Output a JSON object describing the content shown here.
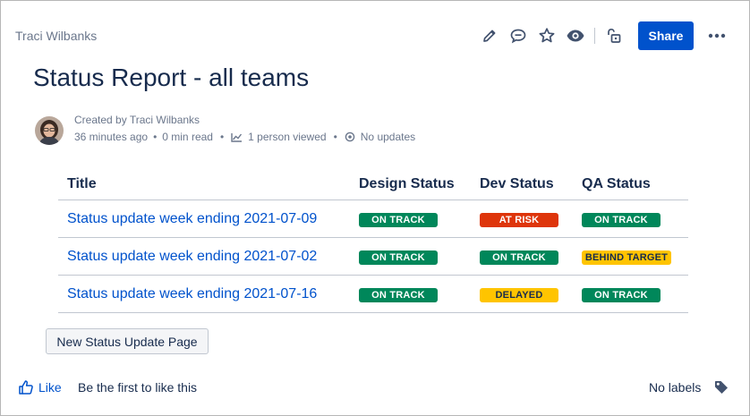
{
  "breadcrumb": "Traci Wilbanks",
  "toolbar": {
    "icons": [
      "edit-icon",
      "comment-icon",
      "star-icon",
      "watch-icon",
      "unlock-icon"
    ],
    "share_label": "Share",
    "more_icon": "more-icon"
  },
  "page": {
    "title": "Status Report - all teams",
    "created_by": "Created by Traci Wilbanks",
    "time_ago": "36 minutes ago",
    "read_time": "0 min read",
    "viewed": "1 person viewed",
    "updates": "No updates"
  },
  "table": {
    "headers": [
      "Title",
      "Design Status",
      "Dev Status",
      "QA Status"
    ],
    "rows": [
      {
        "title": "Status update week ending 2021-07-09",
        "design": "ON TRACK",
        "dev": "AT RISK",
        "qa": "ON TRACK"
      },
      {
        "title": "Status update week ending 2021-07-02",
        "design": "ON TRACK",
        "dev": "ON TRACK",
        "qa": "BEHIND TARGET"
      },
      {
        "title": "Status update week ending 2021-07-16",
        "design": "ON TRACK",
        "dev": "DELAYED",
        "qa": "ON TRACK"
      }
    ]
  },
  "new_page_button": "New Status Update Page",
  "footer": {
    "like_label": "Like",
    "first_like": "Be the first to like this",
    "labels": "No labels"
  },
  "colors": {
    "accent": "#0052cc",
    "on_track": "#00875a",
    "at_risk": "#de350b",
    "warning": "#ffc400"
  }
}
